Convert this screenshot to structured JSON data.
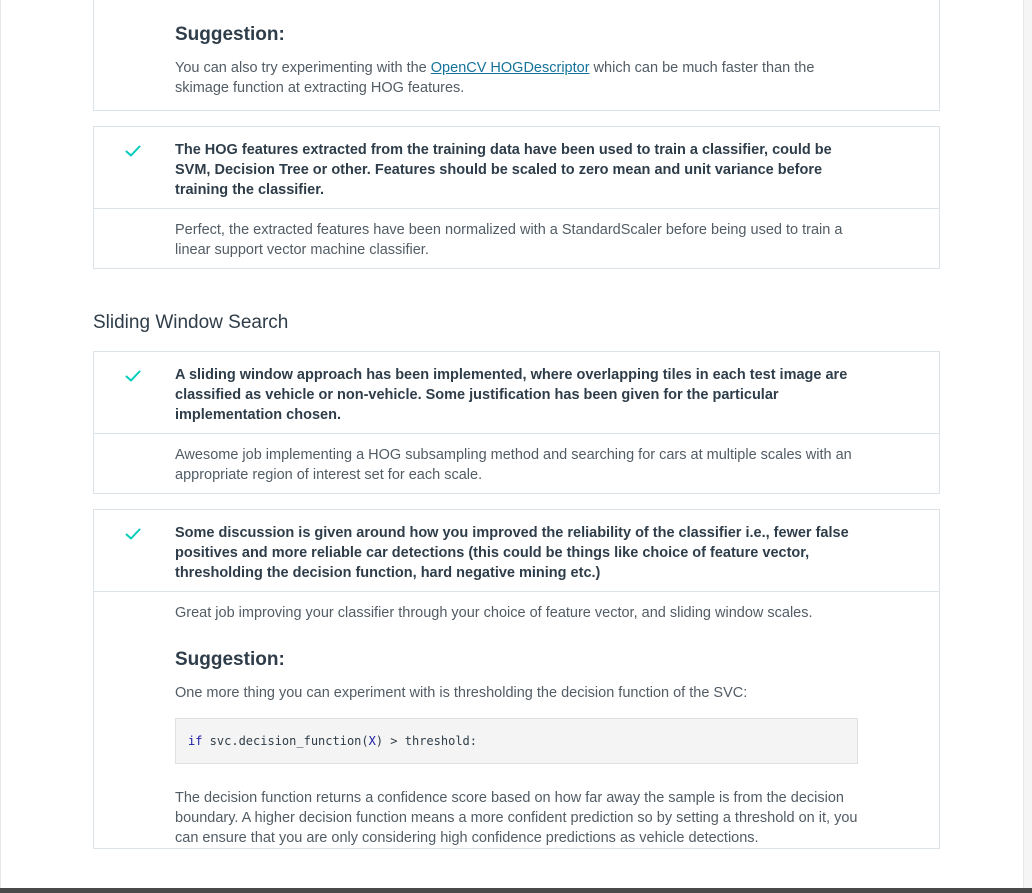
{
  "top_card": {
    "suggestion_title": "Suggestion:",
    "text_before": "You can also try experimenting with the ",
    "link_text": "OpenCV HOGDescriptor",
    "text_after": " which can be much faster than the skimage function at extracting HOG features."
  },
  "classifier_card": {
    "criterion": "The HOG features extracted from the training data have been used to train a classifier, could be SVM, Decision Tree or other. Features should be scaled to zero mean and unit variance before training the classifier.",
    "feedback": "Perfect, the extracted features have been normalized with a StandardScaler before being used to train a linear support vector machine classifier."
  },
  "section": {
    "title": "Sliding Window Search"
  },
  "sliding_card": {
    "criterion": "A sliding window approach has been implemented, where overlapping tiles in each test image are classified as vehicle or non-vehicle. Some justification has been given for the particular implementation chosen.",
    "feedback": "Awesome job implementing a HOG subsampling method and searching for cars at multiple scales with an appropriate region of interest set for each scale."
  },
  "reliability_card": {
    "criterion": "Some discussion is given around how you improved the reliability of the classifier i.e., fewer false positives and more reliable car detections (this could be things like choice of feature vector, thresholding the decision function, hard negative mining etc.)",
    "feedback": "Great job improving your classifier through your choice of feature vector, and sliding window scales.",
    "suggestion_title": "Suggestion:",
    "suggestion_text": "One more thing you can experiment with is thresholding the decision function of the SVC:",
    "code": {
      "kw": "if",
      "obj": " svc.decision_function(",
      "arg": "X",
      "rest": ") > threshold:"
    },
    "closing_text": "The decision function returns a confidence score based on how far away the sample is from the decision boundary. A higher decision function means a more confident prediction so by setting a threshold on it, you can ensure that you are only considering high confidence predictions as vehicle detections."
  },
  "colors": {
    "check": "#02ccba",
    "text_dark": "#2e3d49",
    "text_body": "#525c65",
    "border": "#dbe2e8",
    "link": "#15739a"
  },
  "icons": {
    "check": "check-icon"
  }
}
